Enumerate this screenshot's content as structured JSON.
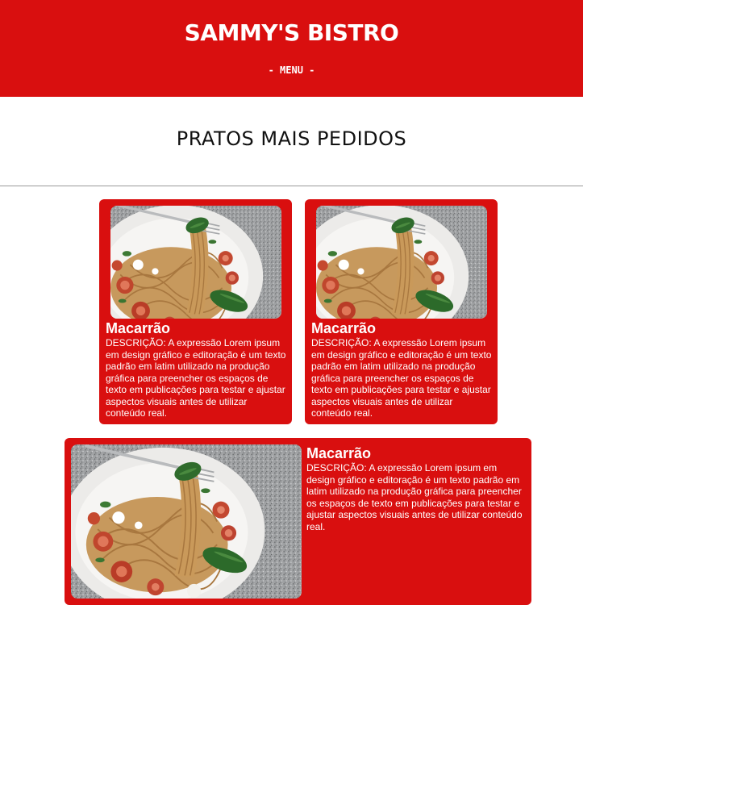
{
  "header": {
    "title": "SAMMY'S BISTRO",
    "menu_label": "- MENU -"
  },
  "section": {
    "title": "PRATOS MAIS PEDIDOS"
  },
  "cards": [
    {
      "name": "Macarrão",
      "description": "DESCRIÇÃO: A expressão Lorem ipsum em design gráfico e editoração é um texto padrão em latim utilizado na produção gráfica para preencher os espaços de texto em publicações para testar e ajustar aspectos visuais antes de utilizar conteúdo real.",
      "image_alt": "Prato de macarrão com tomate e manjericão"
    },
    {
      "name": "Macarrão",
      "description": "DESCRIÇÃO: A expressão Lorem ipsum em design gráfico e editoração é um texto padrão em latim utilizado na produção gráfica para preencher os espaços de texto em publicações para testar e ajustar aspectos visuais antes de utilizar conteúdo real.",
      "image_alt": "Prato de macarrão com tomate e manjericão"
    },
    {
      "name": "Macarrão",
      "description": "DESCRIÇÃO: A expressão Lorem ipsum em design gráfico e editoração é um texto padrão em latim utilizado na produção gráfica para preencher os espaços de texto em publicações para testar e ajustar aspectos visuais antes de utilizar conteúdo real.",
      "image_alt": "Prato de macarrão com tomate e manjericão"
    }
  ],
  "colors": {
    "brand_red": "#d90f0f",
    "text_on_red": "#ffffff",
    "divider": "#9a9a9a"
  }
}
